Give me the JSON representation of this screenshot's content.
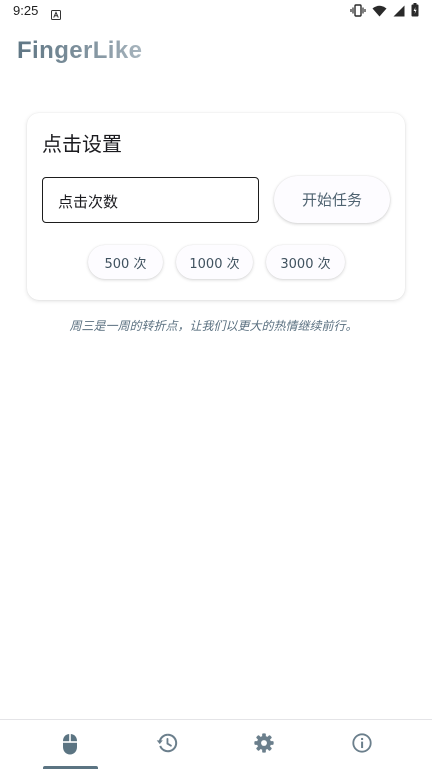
{
  "status_bar": {
    "time": "9:25",
    "icons": [
      "notification-a-icon",
      "vibrate-icon",
      "wifi-icon",
      "cell-signal-icon",
      "battery-icon"
    ]
  },
  "app": {
    "title": "FingerLike",
    "title_colors": [
      "#5f7684",
      "#a9b6bf"
    ]
  },
  "card": {
    "title": "点击设置",
    "count_input": {
      "placeholder": "点击次数",
      "value": ""
    },
    "start_button_label": "开始任务",
    "presets": [
      "500 次",
      "1000 次",
      "3000 次"
    ]
  },
  "quote": "周三是一周的转折点，让我们以更大的热情继续前行。",
  "bottom_nav": {
    "items": [
      {
        "icon": "mouse-icon",
        "selected": true
      },
      {
        "icon": "history-icon",
        "selected": false
      },
      {
        "icon": "settings-icon",
        "selected": false
      },
      {
        "icon": "info-icon",
        "selected": false
      }
    ]
  },
  "colors": {
    "accent": "#5b7482",
    "icon_inactive": "#6b7f8c",
    "quote_text": "#5a7080"
  }
}
